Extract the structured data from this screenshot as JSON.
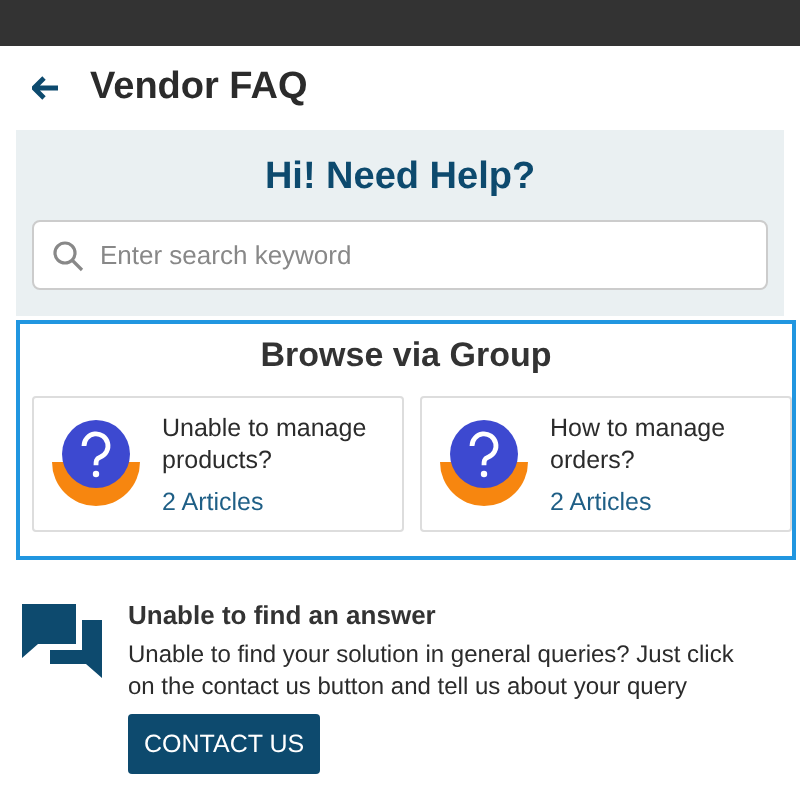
{
  "header": {
    "title": "Vendor FAQ"
  },
  "hero": {
    "title": "Hi! Need Help?",
    "search": {
      "placeholder": "Enter search keyword"
    }
  },
  "browse": {
    "title": "Browse via Group",
    "groups": [
      {
        "title": "Unable to manage products?",
        "count": "2 Articles"
      },
      {
        "title": "How to manage orders?",
        "count": "2 Articles"
      }
    ]
  },
  "contact": {
    "title": "Unable to find an answer",
    "text": "Unable to find your solution in general queries? Just click on the contact us button and tell us about your query",
    "button": "CONTACT US"
  }
}
